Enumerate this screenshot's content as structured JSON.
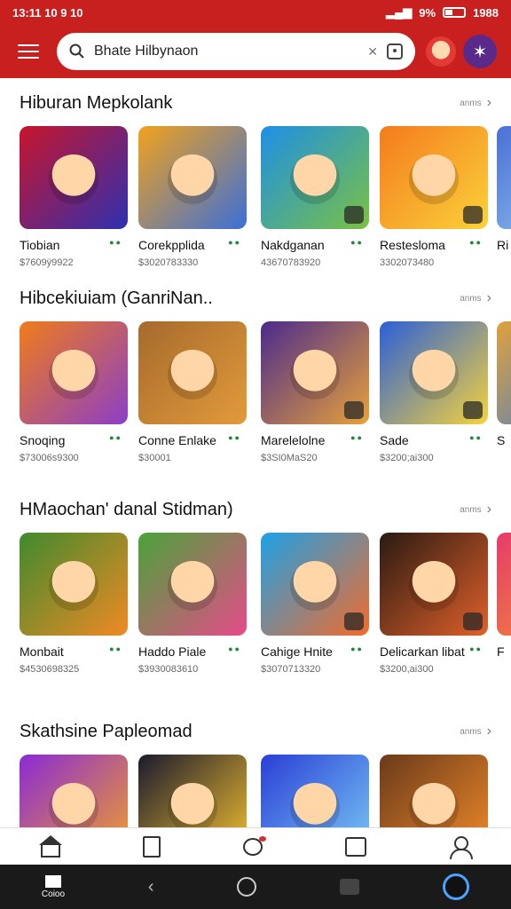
{
  "status_bar": {
    "time": "13:11 10 9 10",
    "battery": "9%",
    "clock_right": "1988"
  },
  "search": {
    "value": "Bhate Hilbynaon"
  },
  "sections": [
    {
      "title": "Hiburan Mepkolank",
      "cards": [
        {
          "name": "Tiobian",
          "meta": "$7609ÿ9922",
          "colors": [
            "#c7152c",
            "#2f2fb0"
          ]
        },
        {
          "name": "Corekpplida",
          "meta": "$3020783330",
          "colors": [
            "#f2a21c",
            "#3b6fd8"
          ]
        },
        {
          "name": "Nakdganan",
          "meta": "43670783920",
          "colors": [
            "#1d8fe6",
            "#7ac143"
          ]
        },
        {
          "name": "Restesloma",
          "meta": "3302073480",
          "colors": [
            "#f47b1c",
            "#fbd23a"
          ]
        },
        {
          "name": "Ri",
          "meta": "",
          "colors": [
            "#4a6fd6",
            "#9ad0f0"
          ]
        }
      ]
    },
    {
      "title": "Hibcekiuiam (GanriNan..",
      "cards": [
        {
          "name": "Snoqing",
          "meta": "$73006s9300",
          "colors": [
            "#f07c1a",
            "#8b3ec7"
          ]
        },
        {
          "name": "Conne Enlake",
          "meta": "$30001",
          "colors": [
            "#a56a2c",
            "#e39a3b"
          ]
        },
        {
          "name": "Marelelolne",
          "meta": "$3SI0MaS20",
          "colors": [
            "#4b2a8c",
            "#e7a13a"
          ]
        },
        {
          "name": "Sade",
          "meta": "$3200;ai300",
          "colors": [
            "#2b5fd6",
            "#f5d23c"
          ]
        },
        {
          "name": "S",
          "meta": "",
          "colors": [
            "#e0a13c",
            "#3a7bd5"
          ]
        }
      ]
    },
    {
      "title": "HMaochan' danal Stidman)",
      "cards": [
        {
          "name": "Monbait",
          "meta": "$4530698325",
          "colors": [
            "#3f8a2e",
            "#f08a24"
          ]
        },
        {
          "name": "Haddo Piale",
          "meta": "$3930083610",
          "colors": [
            "#4aa33a",
            "#e64b8a"
          ]
        },
        {
          "name": "Cahige Hnite",
          "meta": "$3070713320",
          "colors": [
            "#1da1e8",
            "#f26b2a"
          ]
        },
        {
          "name": "Delicarkan libat",
          "meta": "$3200,ai300",
          "colors": [
            "#2a1a12",
            "#e0602a"
          ]
        },
        {
          "name": "F",
          "meta": "",
          "colors": [
            "#e63b6b",
            "#f29a2c"
          ]
        }
      ]
    },
    {
      "title": "Skathsine Papleomad",
      "cards": [
        {
          "name": "",
          "meta": "",
          "colors": [
            "#8a2ad6",
            "#f0a02a"
          ]
        },
        {
          "name": "",
          "meta": "",
          "colors": [
            "#1a1a2e",
            "#f5c030"
          ]
        },
        {
          "name": "",
          "meta": "",
          "colors": [
            "#2a3fd6",
            "#7ac8f5"
          ]
        },
        {
          "name": "",
          "meta": "",
          "colors": [
            "#6a3a1a",
            "#f08a2a"
          ]
        }
      ]
    }
  ],
  "section_more_label": "anms",
  "bottom_nav": [
    "home-icon",
    "bookmark-icon",
    "chat-icon",
    "card-icon",
    "user-icon"
  ],
  "system_bar": {
    "home_label": "Coioo"
  }
}
